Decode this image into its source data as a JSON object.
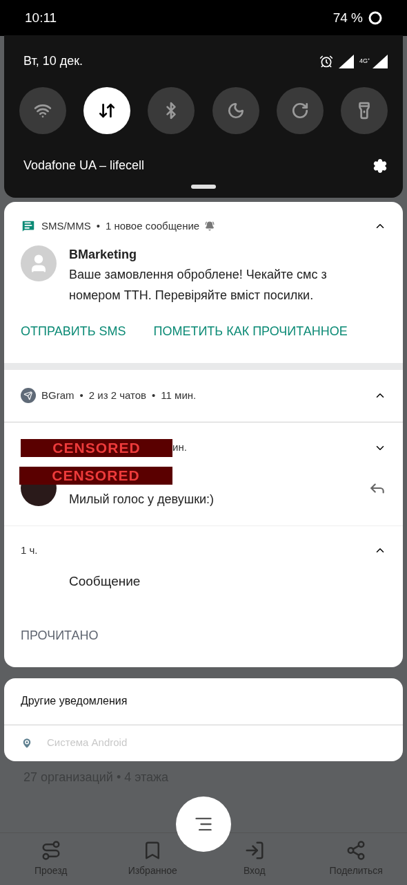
{
  "status_bar": {
    "time": "10:11",
    "battery": "74 %"
  },
  "quick_settings": {
    "date": "Вт, 10 дек.",
    "network_4g": "4G⁺",
    "tiles": [
      {
        "kind": "wifi",
        "on": false
      },
      {
        "kind": "data",
        "on": true
      },
      {
        "kind": "bluetooth",
        "on": false
      },
      {
        "kind": "night",
        "on": false
      },
      {
        "kind": "rotate",
        "on": false
      },
      {
        "kind": "flashlight",
        "on": false
      }
    ],
    "carrier": "Vodafone UA – lifecell"
  },
  "sms_notification": {
    "separator": "•",
    "app": "SMS/MMS",
    "summary": "1 новое сообщение",
    "sender": "BMarketing",
    "message": "Ваше замовлення оброблене! Чекайте смс з номером ТТН. Перевіряйте вміст посилки.",
    "actions": [
      "ОТПРАВИТЬ SMS",
      "ПОМЕТИТЬ КАК ПРОЧИТАННОЕ"
    ]
  },
  "bgram_notification": {
    "separators": [
      "•",
      "•"
    ],
    "app": "BGram",
    "chats": "2 из 2 чатов",
    "time": "11 мин.",
    "conversation": {
      "redactions": [
        "CENSORED",
        "CENSORED"
      ],
      "time_fragment": "ин.",
      "message": "Милый голос у девушки:)"
    },
    "group": {
      "time": "1 ч.",
      "message": "Сообщение",
      "action": "ПРОЧИТАНО"
    }
  },
  "other_notifications": {
    "title": "Другие уведомления",
    "source": "Система Android"
  },
  "background_app": {
    "place_details": "27 организаций • 4 этажа",
    "nav": [
      "Проезд",
      "Избранное",
      "Вход",
      "Поделиться"
    ]
  }
}
